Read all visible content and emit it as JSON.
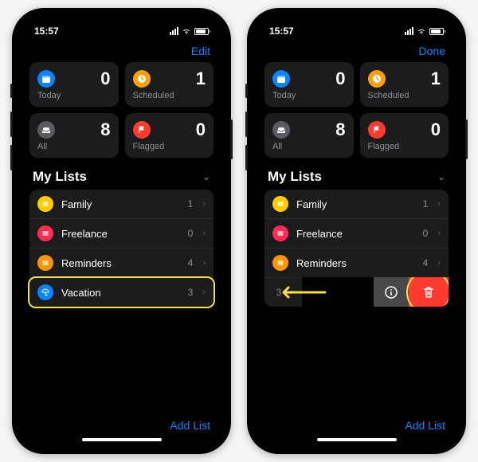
{
  "status": {
    "time": "15:57"
  },
  "nav": {
    "edit": "Edit",
    "done": "Done"
  },
  "cards": {
    "today": {
      "label": "Today",
      "count": "0",
      "color": "#0a84ff"
    },
    "scheduled": {
      "label": "Scheduled",
      "count": "1",
      "color": "#ff9f0a"
    },
    "all": {
      "label": "All",
      "count": "8",
      "color": "#5b5b60"
    },
    "flagged": {
      "label": "Flagged",
      "count": "0",
      "color": "#ff3b30"
    }
  },
  "section": {
    "title": "My Lists"
  },
  "lists": {
    "family": {
      "label": "Family",
      "count": "1",
      "color": "#ffcc00"
    },
    "freelance": {
      "label": "Freelance",
      "count": "0",
      "color": "#ff2d55"
    },
    "reminders": {
      "label": "Reminders",
      "count": "4",
      "color": "#ff9500"
    },
    "vacation": {
      "label": "Vacation",
      "count": "3",
      "color": "#0a84ff"
    }
  },
  "footer": {
    "addList": "Add List"
  }
}
